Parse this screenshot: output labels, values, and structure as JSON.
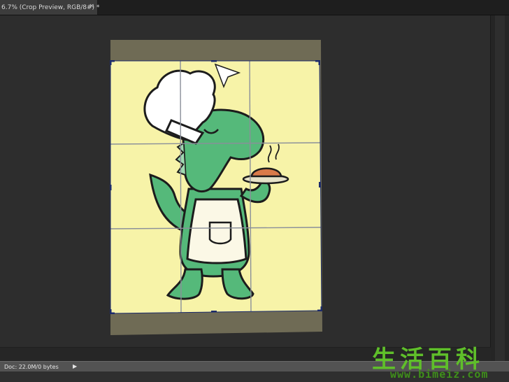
{
  "document_tab": {
    "title": "6.7% (Crop Preview, RGB/8#) *",
    "close_glyph": "×"
  },
  "statusbar": {
    "doc_info": "Doc: 22.0M/0 bytes",
    "menu_glyph": "▶"
  },
  "watermark": {
    "chinese": "生活百科",
    "url": "www.bimeiz.com"
  },
  "colors": {
    "background": "#2d2d2d",
    "canvas_yellow": "#f7f3a8",
    "cropped_shade": "#6f6b55",
    "dino_green": "#55b97a",
    "grid_line": "#8a8f9a",
    "crop_handle": "#1b2a6b"
  }
}
